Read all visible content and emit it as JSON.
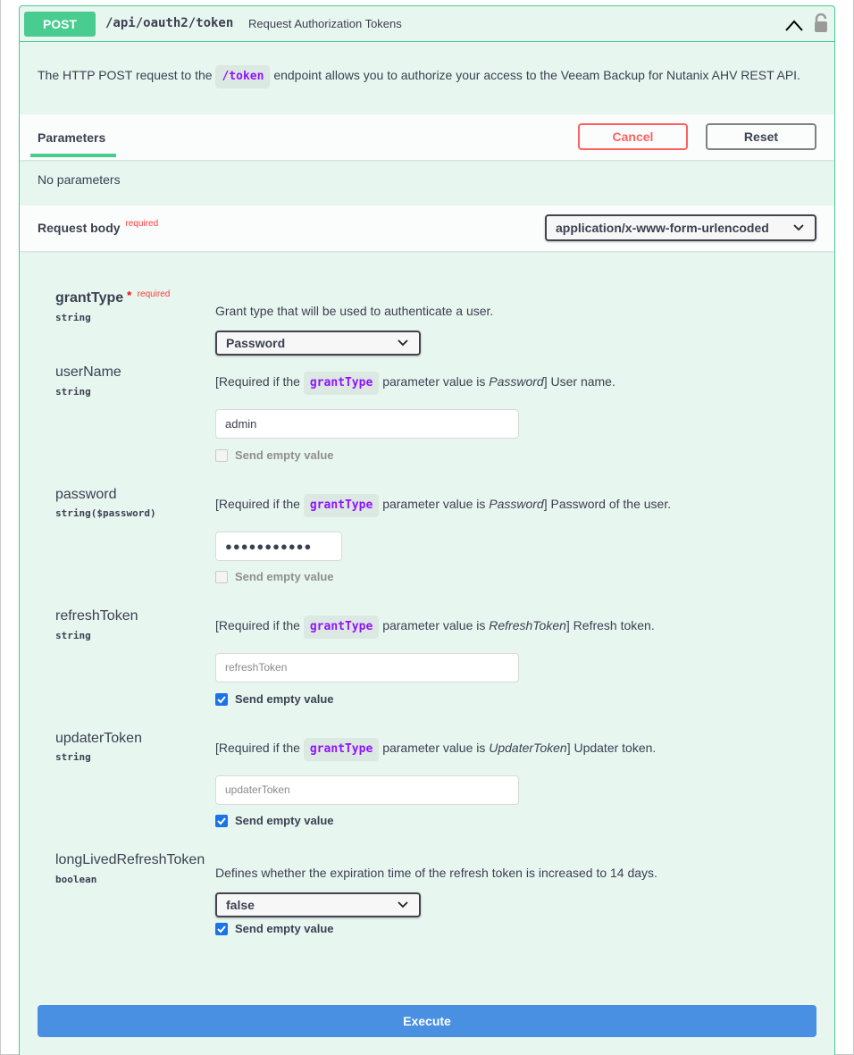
{
  "summary": {
    "method": "POST",
    "path": "/api/oauth2/token",
    "description": "Request Authorization Tokens"
  },
  "description": {
    "before": "The HTTP POST request to the",
    "code": "/token",
    "after": "endpoint allows you to authorize your access to the Veeam Backup for Nutanix AHV REST API."
  },
  "parameters": {
    "tab_label": "Parameters",
    "cancel_label": "Cancel",
    "reset_label": "Reset",
    "empty_text": "No parameters"
  },
  "request_body": {
    "title": "Request body",
    "required_label": "required",
    "content_type": "application/x-www-form-urlencoded"
  },
  "fields": {
    "grantType": {
      "name": "grantType",
      "star": "*",
      "required_label": "required",
      "type": "string",
      "description": "Grant type that will be used to authenticate a user.",
      "value": "Password"
    },
    "userName": {
      "name": "userName",
      "type": "string",
      "desc_prefix": "[Required if the",
      "desc_code": "grantType",
      "desc_mid": "parameter value is",
      "desc_value": "Password",
      "desc_suffix": "] User name.",
      "value": "admin",
      "send_empty_label": "Send empty value",
      "send_empty_checked": false
    },
    "password": {
      "name": "password",
      "type": "string($password)",
      "desc_prefix": "[Required if the",
      "desc_code": "grantType",
      "desc_mid": "parameter value is",
      "desc_value": "Password",
      "desc_suffix": "] Password of the user.",
      "value": "●●●●●●●●●●●",
      "send_empty_label": "Send empty value",
      "send_empty_checked": false
    },
    "refreshToken": {
      "name": "refreshToken",
      "type": "string",
      "desc_prefix": "[Required if the",
      "desc_code": "grantType",
      "desc_mid": "parameter value is",
      "desc_value": "RefreshToken",
      "desc_suffix": "] Refresh token.",
      "placeholder": "refreshToken",
      "send_empty_label": "Send empty value",
      "send_empty_checked": true
    },
    "updaterToken": {
      "name": "updaterToken",
      "type": "string",
      "desc_prefix": "[Required if the",
      "desc_code": "grantType",
      "desc_mid": "parameter value is",
      "desc_value": "UpdaterToken",
      "desc_suffix": "] Updater token.",
      "placeholder": "updaterToken",
      "send_empty_label": "Send empty value",
      "send_empty_checked": true
    },
    "longLivedRefreshToken": {
      "name": "longLivedRefreshToken",
      "type": "boolean",
      "description": "Defines whether the expiration time of the refresh token is increased to 14 days.",
      "value": "false",
      "send_empty_label": "Send empty value",
      "send_empty_checked": true
    }
  },
  "execute_label": "Execute",
  "colors": {
    "post": "#49cc90",
    "cancel": "#ff6060",
    "execute": "#4990e2",
    "checkbox": "#1a73e8",
    "code": "#9012fe"
  },
  "icons": [
    "chevron-up-icon",
    "lock-icon",
    "chevron-down-icon",
    "checkmark-icon"
  ]
}
